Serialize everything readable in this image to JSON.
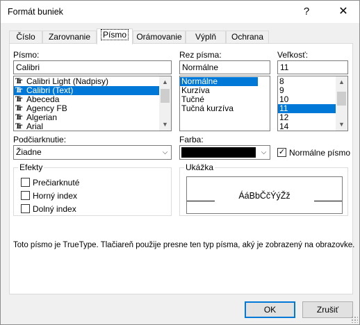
{
  "window": {
    "title": "Formát buniek",
    "help_label": "?",
    "close_label": "✕"
  },
  "tabs": [
    {
      "label": "Číslo",
      "active": false
    },
    {
      "label": "Zarovnanie",
      "active": false
    },
    {
      "label": "Písmo",
      "active": true
    },
    {
      "label": "Orámovanie",
      "active": false
    },
    {
      "label": "Výplň",
      "active": false
    },
    {
      "label": "Ochrana",
      "active": false
    }
  ],
  "font": {
    "label": "Písmo:",
    "value": "Calibri",
    "items": [
      "Calibri Light (Nadpisy)",
      "Calibri (Text)",
      "Abeceda",
      "Agency FB",
      "Algerian",
      "Arial"
    ],
    "selected_index": 1,
    "tt_glyph": "Tr"
  },
  "style": {
    "label": "Rez písma:",
    "value": "Normálne",
    "items": [
      "Normálne",
      "Kurzíva",
      "Tučné",
      "Tučná kurzíva"
    ],
    "selected_index": 0
  },
  "size": {
    "label": "Veľkosť:",
    "value": "11",
    "items": [
      "8",
      "9",
      "10",
      "11",
      "12",
      "14"
    ],
    "selected_index": 3
  },
  "underline": {
    "label": "Podčiarknutie:",
    "value": "Žiadne"
  },
  "color": {
    "label": "Farba:",
    "swatch": "#000000"
  },
  "normal_font": {
    "label": "Normálne písmo",
    "checked": true
  },
  "effects": {
    "title": "Efekty",
    "items": [
      {
        "label": "Prečiarknuté",
        "checked": false
      },
      {
        "label": "Horný index",
        "checked": false
      },
      {
        "label": "Dolný index",
        "checked": false
      }
    ]
  },
  "preview": {
    "title": "Ukážka",
    "text": "ÁáBbČčÝýŽž"
  },
  "info_text": "Toto písmo je TrueType. Tlačiareň použije presne ten typ písma, aký je zobrazený na obrazovke.",
  "buttons": {
    "ok": "OK",
    "cancel": "Zrušiť"
  },
  "icons": {
    "scroll_up": "▲",
    "scroll_down": "▼",
    "dropdown": "⌵",
    "checkmark": "✓"
  },
  "colors": {
    "selection": "#0078d7",
    "dialog_bg": "#f0f0f0"
  }
}
